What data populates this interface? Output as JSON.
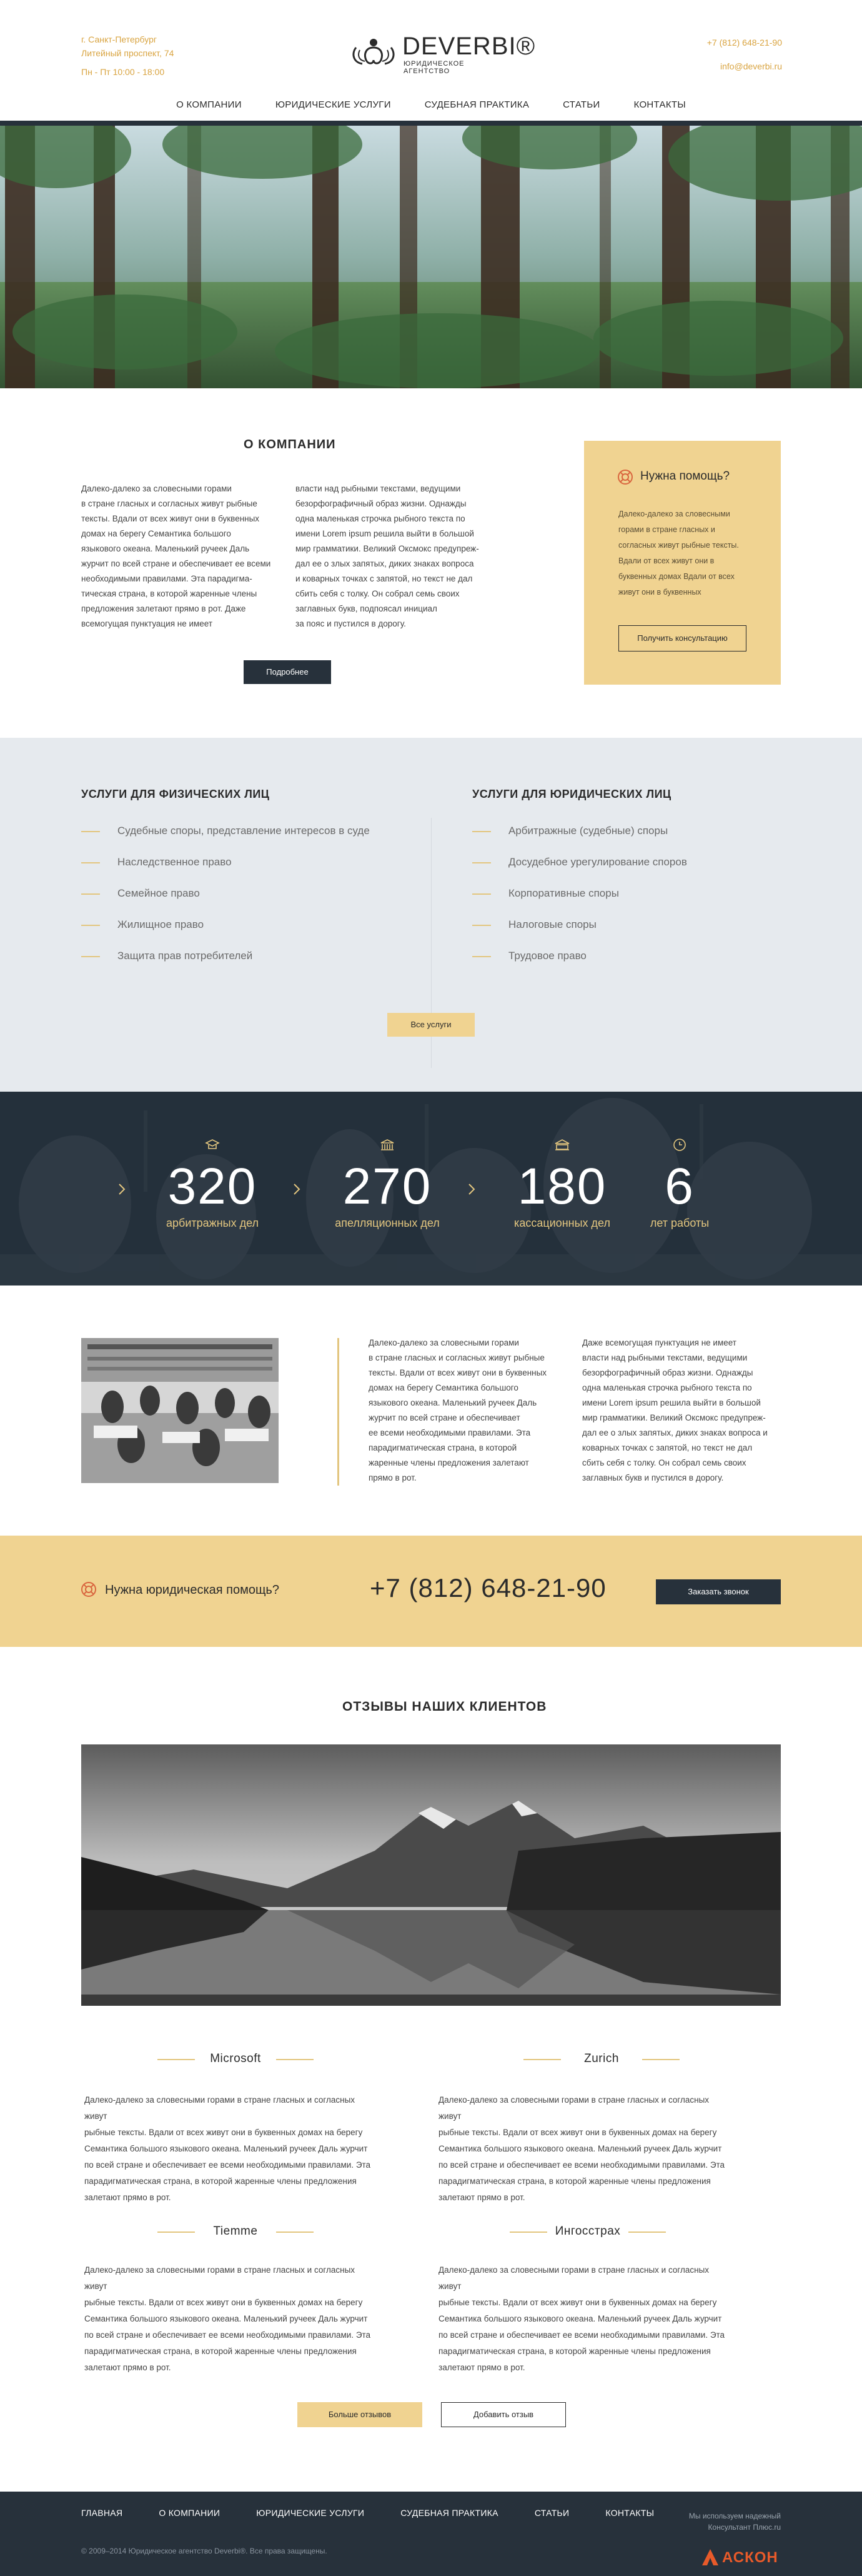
{
  "header": {
    "address_line1": "г. Санкт-Петербург",
    "address_line2": "Литейный проспект, 74",
    "hours": "Пн - Пт 10:00 - 18:00",
    "logo_name": "DEVERBI®",
    "logo_sub": "ЮРИДИЧЕСКОЕ АГЕНТСТВО",
    "phone": "+7 (812) 648-21-90",
    "email": "info@deverbi.ru",
    "accent": "#d9a441"
  },
  "nav": [
    {
      "label": "О КОМПАНИИ"
    },
    {
      "label": "ЮРИДИЧЕСКИЕ УСЛУГИ"
    },
    {
      "label": "СУДЕБНАЯ ПРАКТИКА"
    },
    {
      "label": "СТАТЬИ"
    },
    {
      "label": "КОНТАКТЫ"
    }
  ],
  "about": {
    "title": "О КОМПАНИИ",
    "col1": [
      "Далеко-далеко за словесными горами",
      "в стране гласных и согласных живут рыбные",
      "тексты. Вдали от всех живут они в буквенных",
      "домах на берегу Семантика большого",
      "языкового океана. Маленький ручеек Даль",
      "журчит по всей стране и обеспечивает ее всеми",
      "необходимыми правилами. Эта парадигма-",
      "тическая страна, в которой жаренные члены",
      "предложения залетают прямо в рот. Даже",
      "всемогущая пунктуация не имеет"
    ],
    "col2": [
      "власти над рыбными текстами, ведущими",
      "безорфографичный образ жизни. Однажды",
      "одна маленькая строчка рыбного текста по",
      "имени Lorem ipsum решила выйти в большой",
      "мир грамматики. Великий Оксмокс предупреж-",
      "дал ее о злых запятых, диких знаках вопроса",
      "и коварных точках с запятой, но текст не дал",
      "сбить себя с толку. Он собрал семь своих",
      "заглавных букв, подпоясал инициал",
      "за пояс и пустился в дорогу."
    ],
    "more_label": "Подробнее"
  },
  "help": {
    "title": "Нужна помощь?",
    "text": [
      "Далеко-далеко за словесными",
      "горами в стране гласных и",
      "согласных живут рыбные тексты.",
      "Вдали от всех живут они в",
      "буквенных домах Вдали от всех",
      "живут они в буквенных"
    ],
    "button_label": "Получить консультацию",
    "icon": "lifebuoy-icon"
  },
  "services": {
    "left_title": "УСЛУГИ ДЛЯ ФИЗИЧЕСКИХ ЛИЦ",
    "left": [
      "Судебные споры, представление интересов в суде",
      "Наследственное право",
      "Семейное право",
      "Жилищное право",
      "Защита прав потребителей"
    ],
    "right_title": "УСЛУГИ ДЛЯ ЮРИДИЧЕСКИХ ЛИЦ",
    "right": [
      "Арбитражные (судебные) споры",
      "Досудебное урегулирование споров",
      "Корпоративные споры",
      "Налоговые споры",
      "Трудовое право"
    ],
    "all_label": "Все услуги"
  },
  "stats": [
    {
      "value": "320",
      "label": "арбитражных дел",
      "icon": "graduation-cap-icon"
    },
    {
      "value": "270",
      "label": "апелляционных дел",
      "icon": "courthouse-icon"
    },
    {
      "value": "180",
      "label": "кассационных дел",
      "icon": "bank-icon"
    },
    {
      "value": "6",
      "label": "лет работы",
      "icon": "clock-icon"
    }
  ],
  "info": {
    "col1": [
      "Далеко-далеко за словесными горами",
      "в стране гласных и согласных живут рыбные",
      "тексты. Вдали от всех живут они в буквенных",
      "домах на берегу Семантика большого",
      "языкового океана. Маленький ручеек Даль",
      "журчит по всей стране и обеспечивает",
      "ее всеми необходимыми правилами. Эта",
      "парадигматическая страна, в которой",
      "жаренные члены предложения залетают",
      "прямо в рот."
    ],
    "col2": [
      "Даже всемогущая пунктуация не имеет",
      "власти над рыбными текстами, ведущими",
      "безорфографичный образ жизни. Однажды",
      "одна маленькая строчка рыбного текста по",
      "имени Lorem ipsum решила выйти в большой",
      "мир грамматики. Великий Оксмокс предупреж-",
      "дал ее о злых запятых, диких знаках вопроса и",
      "коварных точках с запятой, но текст не дал",
      "сбить себя с толку. Он собрал семь своих",
      "заглавных букв и пустился в дорогу."
    ]
  },
  "callbar": {
    "question": "Нужна юридическая помощь?",
    "phone": "+7 (812) 648-21-90",
    "button_label": "Заказать звонок"
  },
  "reviews": {
    "title": "ОТЗЫВЫ НАШИХ КЛИЕНТОВ",
    "items": [
      {
        "name": "Microsoft",
        "text": [
          "Далеко-далеко за словесными горами в стране гласных и согласных живут",
          "рыбные тексты. Вдали от всех живут они в буквенных домах на берегу",
          "Семантика большого языкового океана. Маленький ручеек Даль журчит",
          "по всей стране и обеспечивает ее всеми необходимыми правилами. Эта",
          "парадигматическая страна, в которой жаренные члены предложения",
          "залетают прямо в рот."
        ]
      },
      {
        "name": "Zurich",
        "text": [
          "Далеко-далеко за словесными горами в стране гласных и согласных живут",
          "рыбные тексты. Вдали от всех живут они в буквенных домах на берегу",
          "Семантика большого языкового океана. Маленький ручеек Даль журчит",
          "по всей стране и обеспечивает ее всеми необходимыми правилами. Эта",
          "парадигматическая страна, в которой жаренные члены предложения",
          "залетают прямо в рот."
        ]
      },
      {
        "name": "Tiemme",
        "text": [
          "Далеко-далеко за словесными горами в стране гласных и согласных живут",
          "рыбные тексты. Вдали от всех живут они в буквенных домах на берегу",
          "Семантика большого языкового океана. Маленький ручеек Даль журчит",
          "по всей стране и обеспечивает ее всеми необходимыми правилами. Эта",
          "парадигматическая страна, в которой жаренные члены предложения",
          "залетают прямо в рот."
        ]
      },
      {
        "name": "Ингосстрах",
        "text": [
          "Далеко-далеко за словесными горами в стране гласных и согласных живут",
          "рыбные тексты. Вдали от всех живут они в буквенных домах на берегу",
          "Семантика большого языкового океана. Маленький ручеек Даль журчит",
          "по всей стране и обеспечивает ее всеми необходимыми правилами. Эта",
          "парадигматическая страна, в которой жаренные члены предложения",
          "залетают прямо в рот."
        ]
      }
    ],
    "more_label": "Больше отзывов",
    "add_label": "Добавить отзыв"
  },
  "footer": {
    "nav": [
      "ГЛАВНАЯ",
      "О КОМПАНИИ",
      "ЮРИДИЧЕСКИЕ УСЛУГИ",
      "СУДЕБНАЯ ПРАКТИКА",
      "СТАТЬИ",
      "КОНТАКТЫ"
    ],
    "note_line1": "Мы используем надежный",
    "note_line2": "Консультант Плюс.ru",
    "copyright": "© 2009–2014 Юридическое агентство Deverbi®. Все права защищены.",
    "brand": "АСКОН"
  }
}
